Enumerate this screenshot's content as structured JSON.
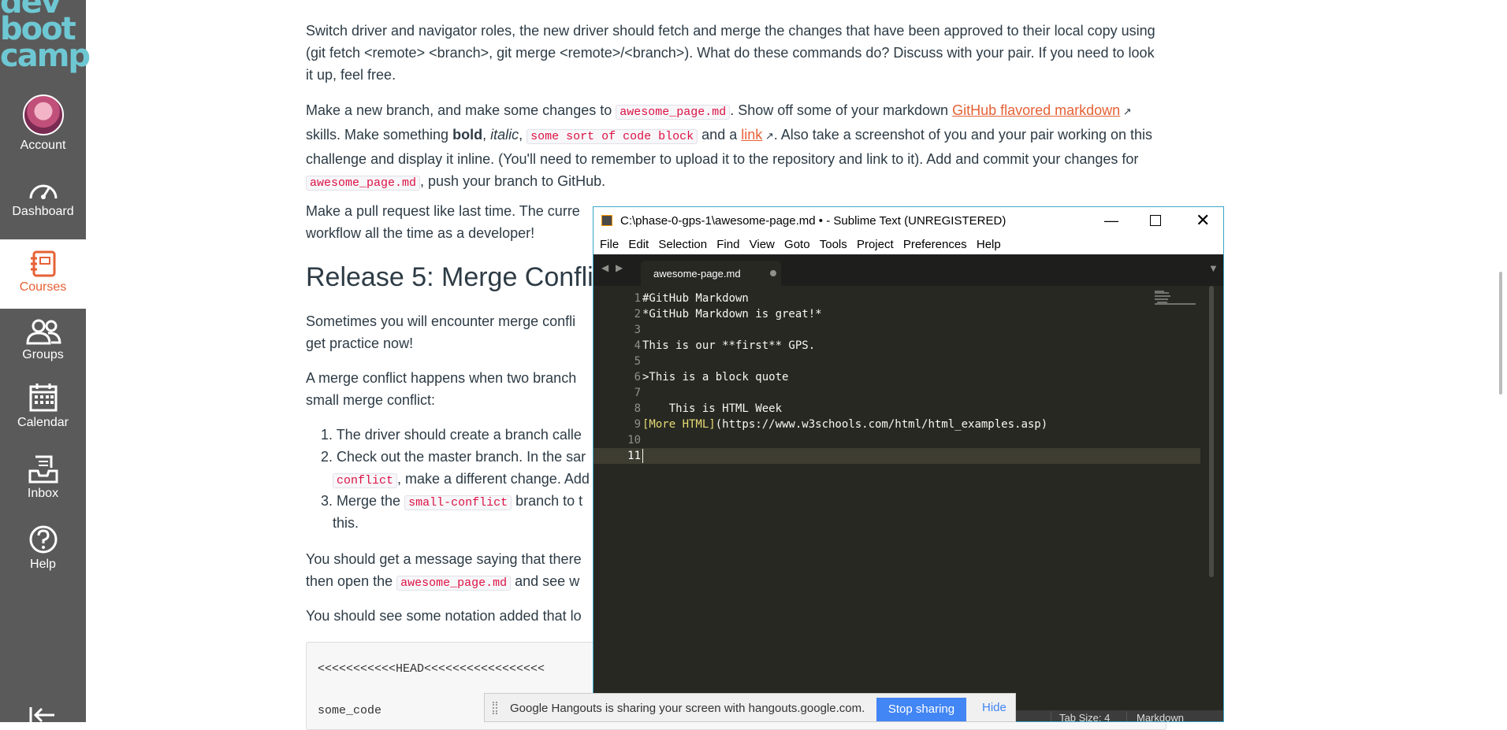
{
  "nav": {
    "logo": [
      "dev",
      "boot",
      "camp"
    ],
    "items": [
      {
        "label": "Account",
        "icon": "avatar"
      },
      {
        "label": "Dashboard",
        "icon": "dashboard-icon"
      },
      {
        "label": "Courses",
        "icon": "courses-icon",
        "active": true
      },
      {
        "label": "Groups",
        "icon": "groups-icon"
      },
      {
        "label": "Calendar",
        "icon": "calendar-icon"
      },
      {
        "label": "Inbox",
        "icon": "inbox-icon"
      },
      {
        "label": "Help",
        "icon": "help-icon"
      }
    ],
    "collapse_icon": "collapse-arrow-icon"
  },
  "article": {
    "p1": "Switch driver and navigator roles, the new driver should fetch and merge the changes that have been approved to their local copy using (git fetch <remote> <branch>, git merge <remote>/<branch>). What do these commands do? Discuss with your pair. If you need to look it up, feel free.",
    "p2": {
      "t1": "Make a new branch, and make some changes to ",
      "code1": "awesome_page.md",
      "t2": ". Show off some of your markdown ",
      "link1": "GitHub flavored markdown",
      "t3": " skills. Make something ",
      "bold": "bold",
      "t4": ", ",
      "italic": "italic",
      "t5": ", ",
      "code2": "some sort of code block",
      "t6": " and a ",
      "link2": "link",
      "t7": ". Also take a screenshot of you and your pair working on this challenge and display it inline. (You'll need to remember to upload it to the repository and link to it). Add and commit your changes for ",
      "code3": "awesome_page.md",
      "t8": ", push your branch to GitHub."
    },
    "p3_line1": "Make a pull request like last time. The curre",
    "p3_line2": "workflow all the time as a developer!",
    "h2": "Release 5: Merge Conflic",
    "p4_line1": "Sometimes you will encounter merge confli",
    "p4_line2": "get practice now!",
    "p5_line1": "A merge conflict happens when two branch",
    "p5_line2": "small merge conflict:",
    "list": {
      "n1": "1.",
      "i1": "The driver should create a branch calle",
      "n2": "2.",
      "i2a": "Check out the master branch. In the sar",
      "i2code": "conflict",
      "i2b": ", make a different change. Add",
      "n3": "3.",
      "i3a": "Merge the ",
      "i3code": "small-conflict",
      "i3b": " branch to t",
      "i3c": "this."
    },
    "p6_line1": "You should get a message saying that there",
    "p6_line2a": "then open the ",
    "p6_code": "awesome_page.md",
    "p6_line2b": " and see w",
    "p7": "You should see some notation added that lo",
    "codeblock": {
      "line1": "<<<<<<<<<<<HEAD<<<<<<<<<<<<<<<<<",
      "line2": "some_code"
    }
  },
  "editor": {
    "title": "C:\\phase-0-gps-1\\awesome-page.md • - Sublime Text (UNREGISTERED)",
    "menu": [
      "File",
      "Edit",
      "Selection",
      "Find",
      "View",
      "Goto",
      "Tools",
      "Project",
      "Preferences",
      "Help"
    ],
    "tab_name": "awesome-page.md",
    "line_numbers": [
      "1",
      "2",
      "3",
      "4",
      "5",
      "6",
      "7",
      "8",
      "9",
      "10",
      "11"
    ],
    "lines": [
      "#GitHub Markdown",
      "*GitHub Markdown is great!*",
      "",
      "This is our **first** GPS.",
      "",
      ">This is a block quote",
      "",
      "    This is HTML Week",
      "",
      "",
      ""
    ],
    "line9_link": "[More HTML]",
    "line9_url": "(https://www.w3schools.com/html/html_examples.asp)",
    "status_tab_size": "Tab Size: 4",
    "status_syntax": "Markdown"
  },
  "hangouts": {
    "message": "Google Hangouts is sharing your screen with hangouts.google.com.",
    "stop": "Stop sharing",
    "hide": "Hide"
  },
  "colors": {
    "nav_bg": "#5a5a5a",
    "accent": "#e66135",
    "logo": "#6ec8d3",
    "editor_bg": "#272822"
  }
}
